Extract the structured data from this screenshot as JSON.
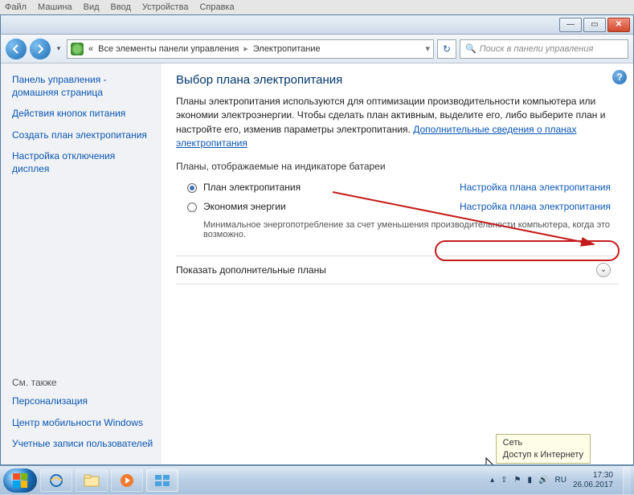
{
  "vm_menu": [
    "Файл",
    "Машина",
    "Вид",
    "Ввод",
    "Устройства",
    "Справка"
  ],
  "address": {
    "root": "Все элементы панели управления",
    "current": "Электропитание"
  },
  "search": {
    "placeholder": "Поиск в панели управления"
  },
  "sidebar": {
    "home": "Панель управления - домашняя страница",
    "links": [
      "Действия кнопок питания",
      "Создать план электропитания",
      "Настройка отключения дисплея"
    ],
    "see_also_title": "См. также",
    "see_also": [
      "Персонализация",
      "Центр мобильности Windows",
      "Учетные записи пользователей"
    ]
  },
  "content": {
    "title": "Выбор плана электропитания",
    "intro": "Планы электропитания используются для оптимизации производительности компьютера или экономии электроэнергии. Чтобы сделать план активным, выделите его, либо выберите план и настройте его, изменив параметры электропитания. ",
    "intro_link": "Дополнительные сведения о планах электропитания",
    "section": "Планы, отображаемые на индикаторе батареи",
    "plans": [
      {
        "name": "План электропитания",
        "desc": "",
        "settings": "Настройка плана электропитания",
        "checked": true
      },
      {
        "name": "Экономия энергии",
        "desc": "Минимальное энергопотребление за счет уменьшения производительности компьютера, когда это возможно.",
        "settings": "Настройка плана электропитания",
        "checked": false
      }
    ],
    "expander": "Показать дополнительные планы"
  },
  "tooltip": {
    "title": "Сеть",
    "line": "Доступ к Интернету"
  },
  "tray": {
    "lang": "RU",
    "time": "17:30",
    "date": "26.06.2017"
  },
  "sysbuttons": {
    "min": "—",
    "max": "▭",
    "close": "✕"
  }
}
